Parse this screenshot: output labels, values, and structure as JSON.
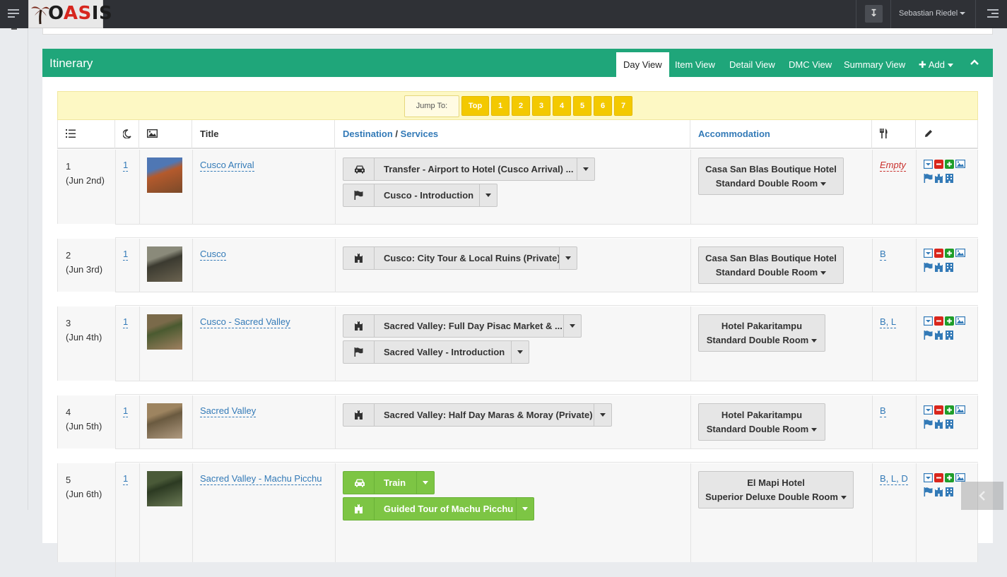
{
  "app": {
    "logo_text_a": "O",
    "logo_text_b": "AS",
    "logo_text_c": "IS",
    "user_name": "Sebastian Riedel"
  },
  "colors": {
    "accent": "#1fa67a",
    "jump_button": "#f3c900",
    "link": "#337ab7",
    "green_service": "#7dc544"
  },
  "panel": {
    "title": "Itinerary",
    "tabs": [
      "Day View",
      "Item View",
      "Detail View",
      "DMC View",
      "Summary View"
    ],
    "active_tab": "Day View",
    "add_label": "Add"
  },
  "jump": {
    "label": "Jump To:",
    "buttons": [
      "Top",
      "1",
      "2",
      "3",
      "4",
      "5",
      "6",
      "7"
    ]
  },
  "table": {
    "headers": {
      "title": "Title",
      "destination": "Destination",
      "sep": "/",
      "services": "Services",
      "accommodation": "Accommodation"
    },
    "rows": [
      {
        "day": "1",
        "date": "(Jun 2nd)",
        "nights": "1",
        "title": "Cusco Arrival",
        "services": [
          {
            "icon": "car-icon",
            "label": "Transfer - Airport to Hotel (Cusco Arrival) ..."
          },
          {
            "icon": "flag-icon",
            "label": "Cusco - Introduction"
          }
        ],
        "hotel": "Casa San Blas Boutique Hotel",
        "room": "Standard Double Room",
        "meals": "Empty"
      },
      {
        "day": "2",
        "date": "(Jun 3rd)",
        "nights": "1",
        "title": "Cusco",
        "services": [
          {
            "icon": "castle-icon",
            "label": "Cusco: City Tour & Local Ruins (Private)"
          }
        ],
        "hotel": "Casa San Blas Boutique Hotel",
        "room": "Standard Double Room",
        "meals": "B"
      },
      {
        "day": "3",
        "date": "(Jun 4th)",
        "nights": "1",
        "title": "Cusco - Sacred Valley",
        "services": [
          {
            "icon": "castle-icon",
            "label": "Sacred Valley: Full Day Pisac Market & ..."
          },
          {
            "icon": "flag-icon",
            "label": "Sacred Valley - Introduction"
          }
        ],
        "hotel": "Hotel Pakaritampu",
        "room": "Standard Double Room",
        "meals": "B, L"
      },
      {
        "day": "4",
        "date": "(Jun 5th)",
        "nights": "1",
        "title": "Sacred Valley",
        "services": [
          {
            "icon": "castle-icon",
            "label": "Sacred Valley: Half Day Maras & Moray (Private)"
          }
        ],
        "hotel": "Hotel Pakaritampu",
        "room": "Standard Double Room",
        "meals": "B"
      },
      {
        "day": "5",
        "date": "(Jun 6th)",
        "nights": "1",
        "title": "Sacred Valley - Machu Picchu",
        "services": [
          {
            "icon": "car-icon",
            "label": "Train"
          },
          {
            "icon": "castle-icon",
            "label": "Guided Tour of Machu Picchu"
          }
        ],
        "hotel": "El Mapi Hotel",
        "room": "Superior Deluxe Double Room",
        "meals": "B, L, D"
      }
    ]
  }
}
